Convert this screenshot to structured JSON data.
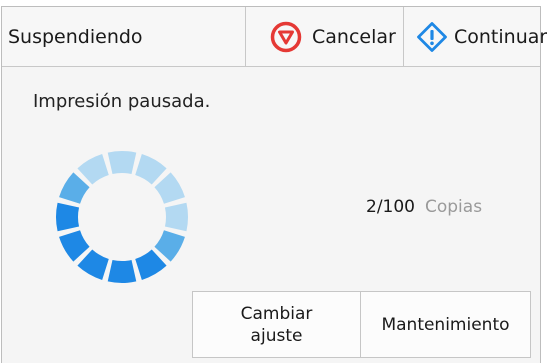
{
  "header": {
    "status": "Suspendiendo",
    "cancel_label": "Cancelar",
    "continue_label": "Continuar"
  },
  "main": {
    "message": "Impresión pausada.",
    "progress_count": "2/100",
    "progress_unit": "Copias"
  },
  "footer": {
    "change_label_line1": "Cambiar",
    "change_label_line2": "ajuste",
    "maintenance_label": "Mantenimiento"
  },
  "icons": {
    "cancel": "stop-icon",
    "continue": "continue-icon",
    "spinner": "loading-spinner-icon"
  },
  "colors": {
    "cancel_red": "#e53935",
    "continue_blue": "#1e88e5",
    "spinner_dark": "#1e88e5",
    "spinner_mid": "#5aaee8",
    "spinner_light": "#b3d9f2"
  }
}
